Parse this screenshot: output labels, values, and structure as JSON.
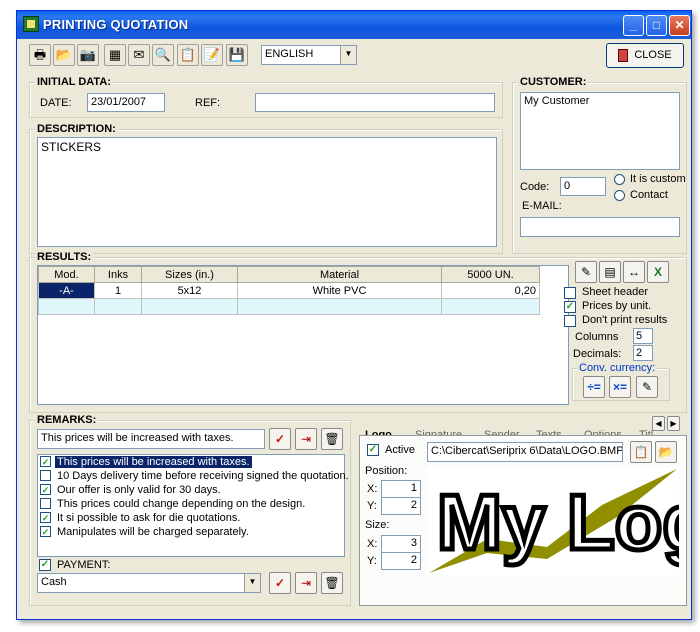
{
  "window": {
    "title": "PRINTING QUOTATION"
  },
  "toolbar": {
    "language": "ENGLISH",
    "close_label": "CLOSE"
  },
  "initial_data": {
    "title": "INITIAL DATA:",
    "date_label": "DATE:",
    "date_value": "23/01/2007",
    "ref_label": "REF:",
    "ref_value": ""
  },
  "customer": {
    "title": "CUSTOMER:",
    "name": "My Customer",
    "code_label": "Code:",
    "code_value": "0",
    "custom_label": "It is custom",
    "contact_label": "Contact",
    "email_label": "E-MAIL:",
    "email_value": ""
  },
  "description": {
    "title": "DESCRIPTION:",
    "text": "STICKERS"
  },
  "results": {
    "title": "RESULTS:",
    "columns": [
      "Mod.",
      "Inks",
      "Sizes (in.)",
      "Material",
      "5000 UN."
    ],
    "row": [
      "-A-",
      "1",
      "5x12",
      "White PVC",
      "0,20"
    ],
    "sheet_header": "Sheet header",
    "prices_by_unit": "Prices by unit.",
    "dont_print": "Don't print results",
    "columns_label": "Columns",
    "columns_value": "5",
    "decimals_label": "Decimals:",
    "decimals_value": "2",
    "conv_currency": "Conv. currency:"
  },
  "remarks": {
    "title": "REMARKS:",
    "input": "This prices will be increased with taxes.",
    "items": [
      {
        "text": "This prices will be increased with taxes.",
        "checked": true
      },
      {
        "text": "10 Days delivery time before receiving signed the quotation.",
        "checked": false
      },
      {
        "text": "Our offer is only valid for 30 days.",
        "checked": true
      },
      {
        "text": "This prices could change depending on the design.",
        "checked": false
      },
      {
        "text": "It si possible to ask for die quotations.",
        "checked": true
      },
      {
        "text": "Manipulates will be charged separately.",
        "checked": true
      }
    ],
    "payment_label": "PAYMENT:",
    "payment_value": "Cash"
  },
  "tabs": [
    "Logo",
    "Signature",
    "Sender",
    "Texts",
    "Options",
    "Titl"
  ],
  "logo": {
    "active_label": "Active",
    "path": "C:\\Cibercat\\Seriprix 6\\Data\\LOGO.BMP",
    "position_label": "Position:",
    "pos_x": "1",
    "pos_y": "2",
    "size_label": "Size:",
    "size_x": "3",
    "size_y": "2",
    "x_label": "X:",
    "y_label": "Y:",
    "image_text": "My Logo"
  },
  "colors": {
    "titlebar": "#0a5ff0",
    "selection": "#0a246a",
    "check": "#21a121",
    "delete_red": "#d01010"
  }
}
